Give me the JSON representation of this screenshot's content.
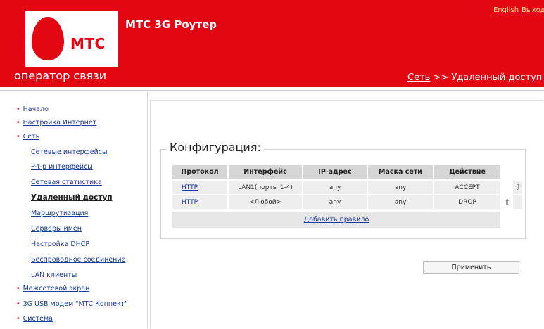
{
  "header": {
    "logo_text": "МТС",
    "tagline": "оператор связи",
    "router_title": "МТС 3G Роутер",
    "lang_links": [
      "English",
      "Выход"
    ],
    "breadcrumb": {
      "link": "Сеть",
      "separator": ">>",
      "current": "Удаленный доступ"
    },
    "colors": {
      "brand": "#e30613",
      "white": "#ffffff"
    }
  },
  "sidebar": {
    "items": [
      {
        "label": "Начало",
        "level": 1
      },
      {
        "label": "Настройка Интернет",
        "level": 1
      },
      {
        "label": "Сеть",
        "level": 1
      },
      {
        "label": "Сетевые интерфейсы",
        "level": 2
      },
      {
        "label": "P-t-p интерфейсы",
        "level": 2
      },
      {
        "label": "Сетевая статистика",
        "level": 2
      },
      {
        "label": "Удаленный доступ",
        "level": 2,
        "active": true
      },
      {
        "label": "Маршрутизация",
        "level": 2
      },
      {
        "label": "Серверы имен",
        "level": 2
      },
      {
        "label": "Настройка DHCP",
        "level": 2
      },
      {
        "label": "Беспроводное соединение",
        "level": 2
      },
      {
        "label": "LAN клиенты",
        "level": 2
      },
      {
        "label": "Межсетевой экран",
        "level": 1
      },
      {
        "label": "3G USB модем \"МТС Коннект\"",
        "level": 1
      },
      {
        "label": "Система",
        "level": 1
      }
    ]
  },
  "main": {
    "section_title": "Конфигурация:",
    "table": {
      "columns": [
        "Протокол",
        "Интерфейс",
        "IP-адрес",
        "Маска сети",
        "Действие"
      ],
      "rows": [
        {
          "protocol": "HTTP",
          "interface": "LAN1(порты 1-4)",
          "ip": "any",
          "mask": "any",
          "action": "ACCEPT",
          "icon": "arrow-down-icon"
        },
        {
          "protocol": "HTTP",
          "interface": "<Любой>",
          "ip": "any",
          "mask": "any",
          "action": "DROP",
          "icon": "arrow-up-icon"
        }
      ],
      "add_rule": "Добавить правило"
    },
    "apply_button": "Применить"
  }
}
